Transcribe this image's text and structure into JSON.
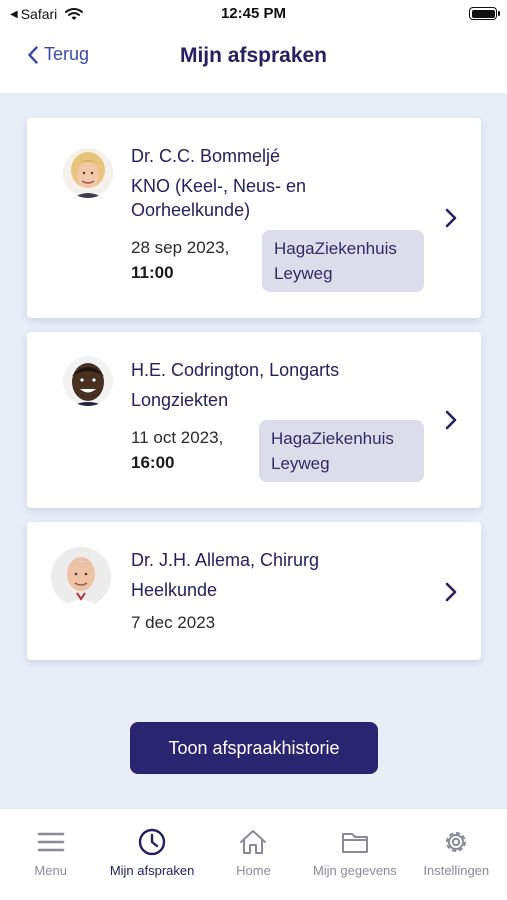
{
  "status_bar": {
    "back_app": "Safari",
    "time": "12:45 PM"
  },
  "nav": {
    "back_label": "Terug",
    "title": "Mijn afspraken"
  },
  "appointments": [
    {
      "doctor": "Dr. C.C. Bommeljé",
      "specialty": "KNO (Keel-, Neus- en Oorheelkunde)",
      "date": "28 sep 2023,",
      "time": "11:00",
      "location": "HagaZiekenhuis Leyweg"
    },
    {
      "doctor": "H.E. Codrington, Longarts",
      "specialty": "Longziekten",
      "date": "11 oct 2023,",
      "time": "16:00",
      "location": "HagaZiekenhuis Leyweg"
    },
    {
      "doctor": "Dr. J.H. Allema, Chirurg",
      "specialty": "Heelkunde",
      "date": "7 dec 2023"
    }
  ],
  "history_button": "Toon afspraakhistorie",
  "tabs": [
    {
      "label": "Menu",
      "icon": "menu-icon"
    },
    {
      "label": "Mijn afspraken",
      "icon": "clock-icon",
      "active": true
    },
    {
      "label": "Home",
      "icon": "home-icon"
    },
    {
      "label": "Mijn gegevens",
      "icon": "folder-icon"
    },
    {
      "label": "Instellingen",
      "icon": "gear-icon"
    }
  ],
  "colors": {
    "primary": "#2b2470",
    "background": "#e8eef8",
    "badge": "#dcdcea",
    "link": "#3b4aa8"
  }
}
